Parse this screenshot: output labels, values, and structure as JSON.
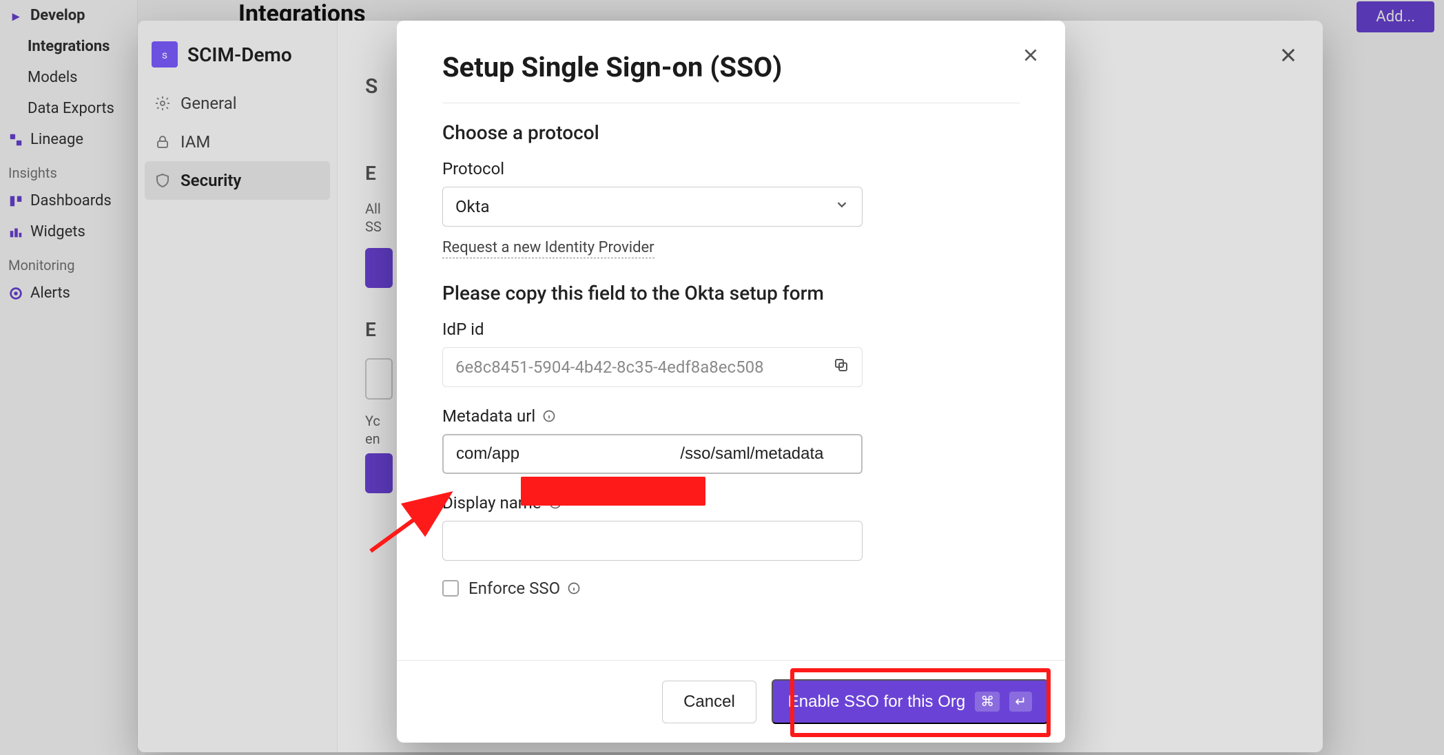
{
  "bg": {
    "develop": "Develop",
    "nav": {
      "integrations": "Integrations",
      "models": "Models",
      "data_exports": "Data Exports",
      "lineage": "Lineage"
    },
    "insights_header": "Insights",
    "dashboards": "Dashboards",
    "widgets": "Widgets",
    "monitoring_header": "Monitoring",
    "alerts": "Alerts",
    "page_title": "Integrations",
    "add_button": "Add..."
  },
  "panel1": {
    "workspace": "SCIM-Demo",
    "avatar_initial": "s",
    "nav": {
      "general": "General",
      "iam": "IAM",
      "security": "Security"
    },
    "hints": {
      "s_label": "S",
      "e1": "E",
      "all": "All",
      "ss": "SS",
      "e2": "E",
      "yc": "Yc",
      "en": "en"
    }
  },
  "modal": {
    "title": "Setup Single Sign-on (SSO)",
    "choose_protocol": "Choose a protocol",
    "protocol_label": "Protocol",
    "protocol_value": "Okta",
    "request_idp": "Request a new Identity Provider",
    "copy_instruction": "Please copy this field to the Okta setup form",
    "idp_id_label": "IdP id",
    "idp_id_value": "6e8c8451-5904-4b42-8c35-4edf8a8ec508",
    "metadata_label": "Metadata url",
    "metadata_value_prefix": "com/app",
    "metadata_value_suffix": "/sso/saml/metadata",
    "display_name_label": "Display name",
    "display_name_value": "",
    "enforce_label": "Enforce SSO",
    "cancel": "Cancel",
    "enable": "Enable SSO for this Org",
    "kbd1": "⌘",
    "kbd2": "↵"
  }
}
